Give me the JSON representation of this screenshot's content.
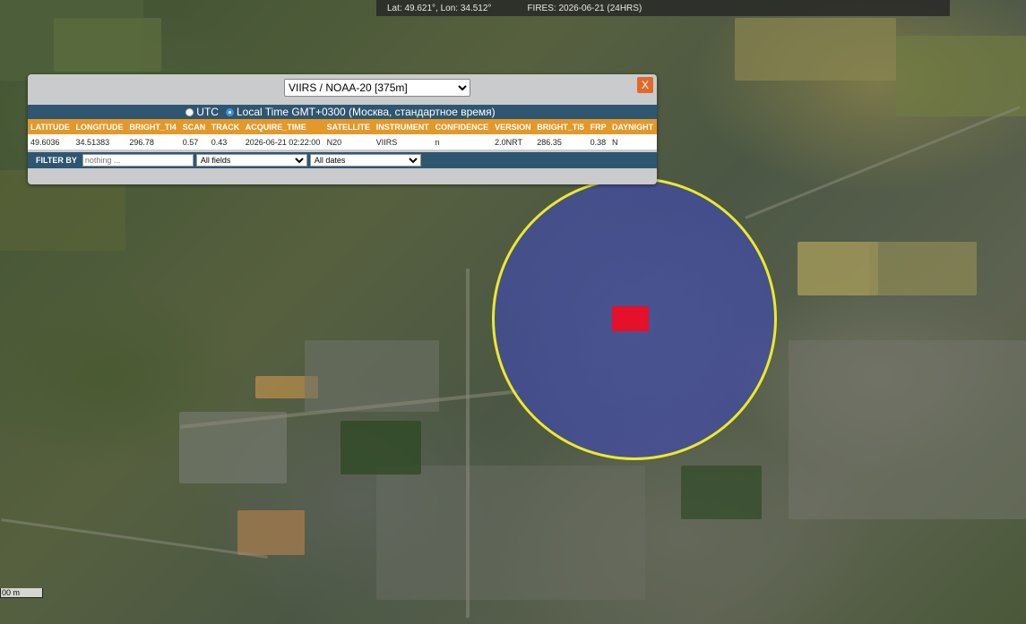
{
  "status_bar": {
    "coords": "Lat: 49.621°, Lon: 34.512°",
    "fires": "FIRES: 2026-06-21 (24HRS)"
  },
  "popup": {
    "satellite_selected": "VIIRS / NOAA-20 [375m]",
    "close_label": "X",
    "tz_utc": "UTC",
    "tz_local": "Local Time GMT+0300 (Москва, стандартное время)",
    "columns": [
      "LATITUDE",
      "LONGITUDE",
      "BRIGHT_TI4",
      "SCAN",
      "TRACK",
      "ACQUIRE_TIME",
      "SATELLITE",
      "INSTRUMENT",
      "CONFIDENCE",
      "VERSION",
      "BRIGHT_TI5",
      "FRP",
      "DAYNIGHT"
    ],
    "rows": [
      [
        "49.6036",
        "34.51383",
        "296.78",
        "0.57",
        "0.43",
        "2026-06-21 02:22:00",
        "N20",
        "VIIRS",
        "n",
        "2.0NRT",
        "286.35",
        "0.38",
        "N"
      ]
    ],
    "filter_label": "FILTER BY",
    "filter_placeholder": "nothing ...",
    "fields_selected": "All fields",
    "dates_selected": "All dates"
  },
  "map": {
    "scale_label": "00 m",
    "circle_color": "#ecea2a",
    "fire_color": "#e5102a"
  },
  "colors": {
    "header_orange": "#e3982a",
    "panel_blue": "#2e5670",
    "close_orange": "#e06a2c"
  }
}
